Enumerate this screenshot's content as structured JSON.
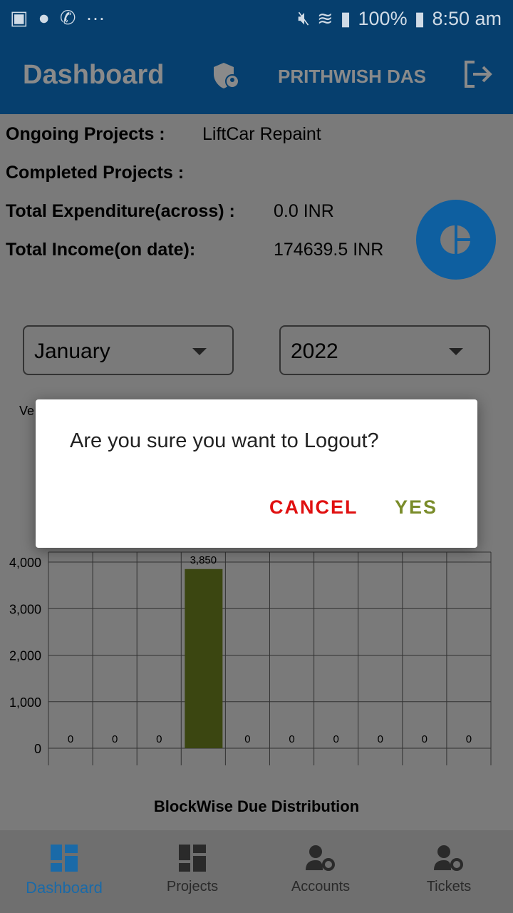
{
  "status_bar": {
    "battery": "100%",
    "time": "8:50 am",
    "icons": [
      "gallery-icon",
      "app-icon",
      "whatsapp-icon",
      "more-icon",
      "mute-icon",
      "wifi-icon",
      "signal-icon",
      "battery-icon"
    ]
  },
  "app_bar": {
    "title": "Dashboard",
    "user_name": "PRITHWISH DAS",
    "icons": [
      "shield-user-icon",
      "logout-icon"
    ]
  },
  "summary": [
    {
      "label": "Ongoing Projects :",
      "value": "LiftCar Repaint"
    },
    {
      "label": "Completed Projects :",
      "value": ""
    },
    {
      "label": "Total Expenditure(across) :",
      "value": "0.0 INR"
    },
    {
      "label": "Total Income(on date):",
      "value": "174639.5 INR"
    }
  ],
  "filters": {
    "month": "January",
    "year": "2022"
  },
  "partial_label": "Ve",
  "chart_data": {
    "type": "bar",
    "title": "BlockWise Due Distribution",
    "categories": [
      "",
      "",
      "",
      "",
      "",
      "",
      "",
      "",
      "",
      ""
    ],
    "values": [
      0,
      0,
      0,
      3850,
      0,
      0,
      0,
      0,
      0,
      0
    ],
    "data_labels": [
      "0",
      "0",
      "0",
      "3,850",
      "0",
      "0",
      "0",
      "0",
      "0",
      "0"
    ],
    "yticks": [
      "0",
      "1,000",
      "2,000",
      "3,000",
      "4,000"
    ],
    "ylim": [
      0,
      4200
    ],
    "grid": true,
    "bar_color": "#6b7f1f"
  },
  "dialog": {
    "message": "Are you sure you want to Logout?",
    "cancel": "CANCEL",
    "yes": "YES",
    "cancel_color": "#e01010",
    "yes_color": "#7a8c2a"
  },
  "bottom_nav": [
    {
      "label": "Dashboard",
      "icon": "dashboard-icon",
      "active": true
    },
    {
      "label": "Projects",
      "icon": "projects-icon",
      "active": false
    },
    {
      "label": "Accounts",
      "icon": "accounts-icon",
      "active": false
    },
    {
      "label": "Tickets",
      "icon": "tickets-icon",
      "active": false
    }
  ]
}
